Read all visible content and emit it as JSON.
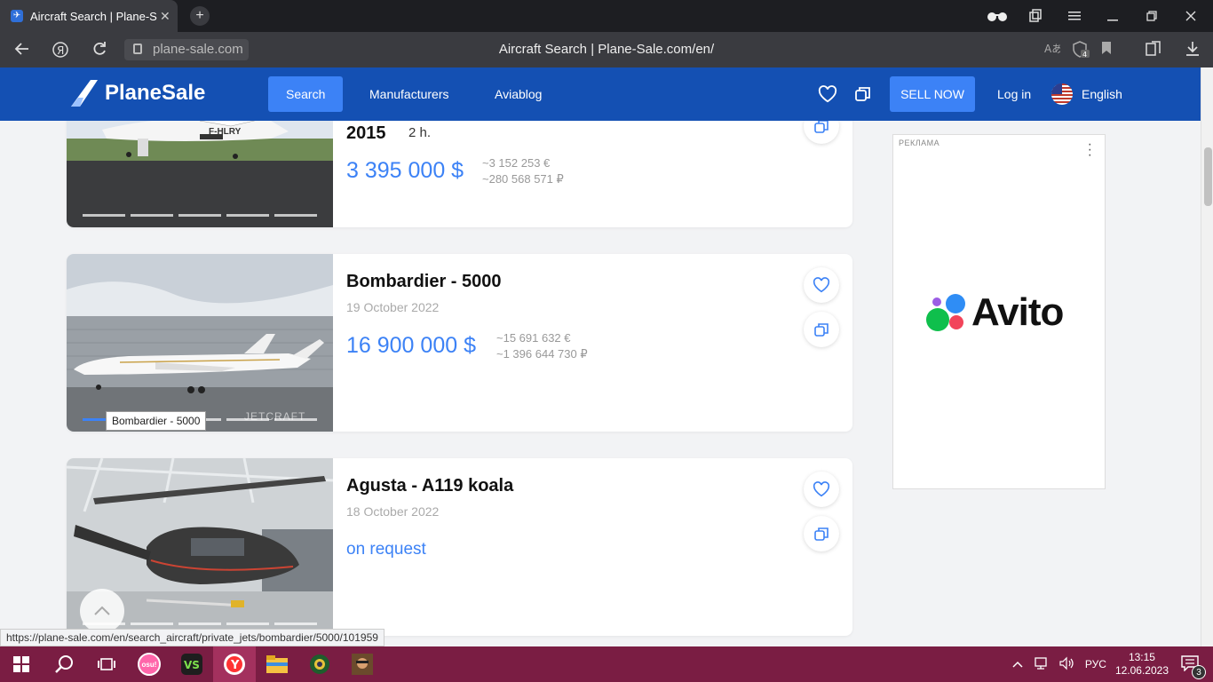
{
  "browser": {
    "tab_title": "Aircraft Search | Plane-S",
    "tab_close": "✕",
    "new_tab": "+",
    "url_pill": "plane-sale.com",
    "page_title": "Aircraft Search | Plane-Sale.com/en/",
    "status_url": "https://plane-sale.com/en/search_aircraft/private_jets/bombardier/5000/101959"
  },
  "site": {
    "logo_text": "PlaneSale",
    "nav": [
      {
        "label": "Search",
        "active": true
      },
      {
        "label": "Manufacturers",
        "active": false
      },
      {
        "label": "Aviablog",
        "active": false
      }
    ],
    "sell_now": "SELL NOW",
    "login": "Log in",
    "language": "English"
  },
  "listings": [
    {
      "title": "2015",
      "subtitle": "2 h.",
      "date": "",
      "price": "3 395 000 $",
      "price_eur": "~3 152 253 €",
      "price_rub": "~280 568 571 ₽",
      "photo_tail": "F-HLRY"
    },
    {
      "title": "Bombardier - 5000",
      "date": "19 October 2022",
      "price": "16 900 000 $",
      "price_eur": "~15 691 632 €",
      "price_rub": "~1 396 644 730 ₽",
      "photo_watermark": "JETCRAFT"
    },
    {
      "title": "Agusta - A119 koala",
      "date": "18 October 2022",
      "price": "on request",
      "price_eur": "",
      "price_rub": ""
    }
  ],
  "tooltip": "Bombardier - 5000",
  "ad": {
    "label": "РЕКЛАМА",
    "brand": "Avito"
  },
  "taskbar": {
    "lang": "РУС",
    "time": "13:15",
    "date": "12.06.2023",
    "notifications": "3",
    "osu_label": "osu!"
  },
  "colors": {
    "header": "#1450b3",
    "accent": "#3c82f6",
    "taskbar": "#7a1d43"
  }
}
